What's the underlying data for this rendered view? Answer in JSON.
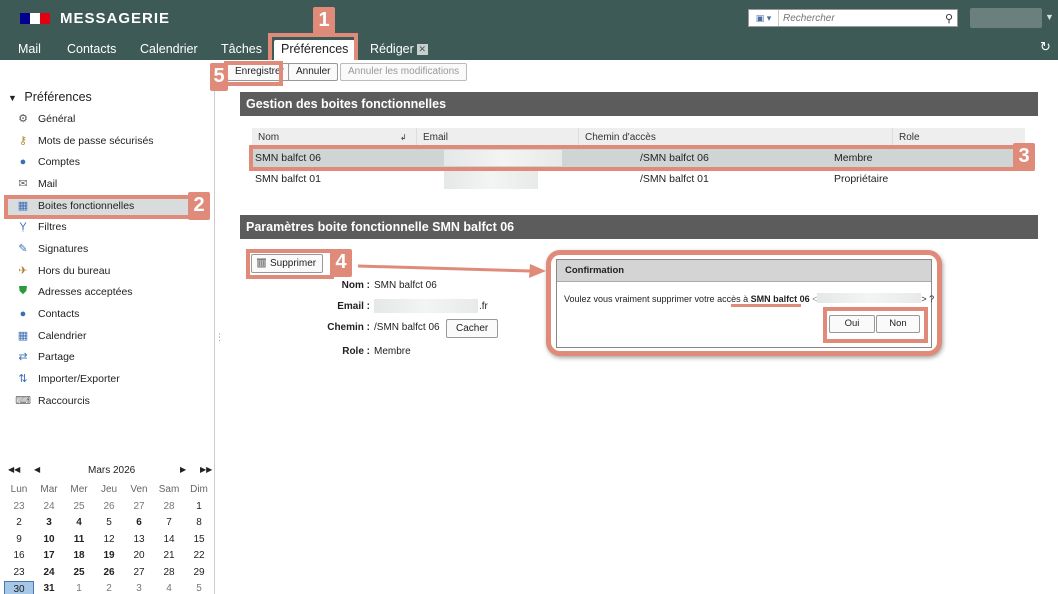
{
  "header": {
    "app_title": "MESSAGERIE",
    "search_placeholder": "Rechercher",
    "flag_colors": [
      "#000091",
      "#ffffff",
      "#e1000f"
    ]
  },
  "nav": {
    "tabs": [
      {
        "label": "Mail"
      },
      {
        "label": "Contacts"
      },
      {
        "label": "Calendrier"
      },
      {
        "label": "Tâches"
      },
      {
        "label": "Préférences",
        "active": true
      },
      {
        "label": "Rédiger",
        "closable": true
      }
    ]
  },
  "toolbar": {
    "save_label": "Enregistrer",
    "cancel_label": "Annuler",
    "undo_label": "Annuler les modifications"
  },
  "sidebar": {
    "title": "Préférences",
    "items": [
      {
        "label": "Général",
        "icon": "gear-icon"
      },
      {
        "label": "Mots de passe sécurisés",
        "icon": "key-icon"
      },
      {
        "label": "Comptes",
        "icon": "accounts-icon"
      },
      {
        "label": "Mail",
        "icon": "mail-icon"
      },
      {
        "label": "Boites fonctionnelles",
        "icon": "shared-mailbox-icon",
        "selected": true
      },
      {
        "label": "Filtres",
        "icon": "filter-icon"
      },
      {
        "label": "Signatures",
        "icon": "signature-icon"
      },
      {
        "label": "Hors du bureau",
        "icon": "out-of-office-icon"
      },
      {
        "label": "Adresses acceptées",
        "icon": "shield-check-icon"
      },
      {
        "label": "Contacts",
        "icon": "contacts-icon"
      },
      {
        "label": "Calendrier",
        "icon": "calendar-icon"
      },
      {
        "label": "Partage",
        "icon": "share-icon"
      },
      {
        "label": "Importer/Exporter",
        "icon": "import-export-icon"
      },
      {
        "label": "Raccourcis",
        "icon": "shortcut-icon"
      }
    ]
  },
  "calendar": {
    "month_label": "Mars 2026",
    "weekdays": [
      "Lun",
      "Mar",
      "Mer",
      "Jeu",
      "Ven",
      "Sam",
      "Dim"
    ],
    "weeks": [
      [
        "23",
        "24",
        "25",
        "26",
        "27",
        "28",
        "1"
      ],
      [
        "2",
        "3",
        "4",
        "5",
        "6",
        "7",
        "8"
      ],
      [
        "9",
        "10",
        "11",
        "12",
        "13",
        "14",
        "15"
      ],
      [
        "16",
        "17",
        "18",
        "19",
        "20",
        "21",
        "22"
      ],
      [
        "23",
        "24",
        "25",
        "26",
        "27",
        "28",
        "29"
      ],
      [
        "30",
        "31",
        "1",
        "2",
        "3",
        "4",
        "5"
      ]
    ]
  },
  "mailboxes": {
    "section_title": "Gestion des boites fonctionnelles",
    "columns": [
      "Nom",
      "Email",
      "Chemin d'accès",
      "Role"
    ],
    "rows": [
      {
        "name": "SMN balfct 06",
        "path": "/SMN balfct 06",
        "role": "Membre",
        "selected": true
      },
      {
        "name": "SMN balfct 01",
        "path": "/SMN balfct 01",
        "role": "Propriétaire"
      }
    ]
  },
  "params": {
    "section_title": "Paramètres boite fonctionnelle SMN balfct 06",
    "delete_label": "Supprimer",
    "name_label": "Nom :",
    "name_value": "SMN balfct 06",
    "email_label": "Email :",
    "email_suffix": ".fr",
    "path_label": "Chemin :",
    "path_value": "/SMN balfct 06",
    "hide_label": "Cacher",
    "role_label": "Role :",
    "role_value": "Membre"
  },
  "dialog": {
    "title": "Confirmation",
    "message_prefix": "Voulez vous vraiment supprimer votre accès à",
    "message_target": "SMN balfct 06",
    "message_open": "<",
    "message_suffix": "> ?",
    "yes_label": "Oui",
    "no_label": "Non"
  },
  "annotations": {
    "color": "#e08b7a",
    "steps": [
      "1",
      "2",
      "3",
      "4",
      "5"
    ]
  }
}
